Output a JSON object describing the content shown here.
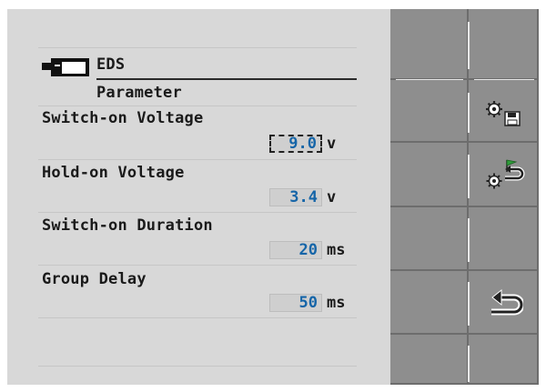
{
  "header": {
    "device_icon": "eds-device-icon",
    "title": "EDS",
    "subtitle": "Parameter"
  },
  "parameters": [
    {
      "label": "Switch-on Voltage",
      "value": "9.0",
      "unit": "v"
    },
    {
      "label": "Hold-on Voltage",
      "value": "3.4",
      "unit": "v"
    },
    {
      "label": "Switch-on Duration",
      "value": "20",
      "unit": "ms"
    },
    {
      "label": "Group Delay",
      "value": "50",
      "unit": "ms"
    }
  ],
  "softkeys": {
    "save_settings_icon": "gear-save-icon",
    "load_defaults_icon": "gear-flag-restore-icon",
    "back_icon": "back-arrow-icon"
  },
  "colors": {
    "value_text": "#1565a8",
    "panel_bg": "#d8d8d8",
    "softkey_bg": "#8e8e8e"
  }
}
